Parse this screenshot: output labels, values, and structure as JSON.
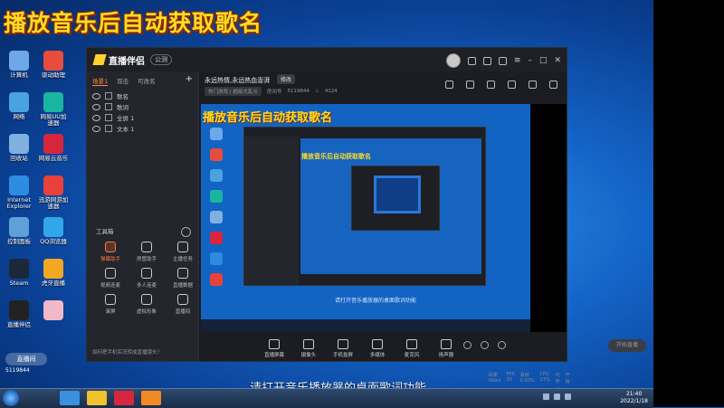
{
  "overlay_title": "播放音乐后自动获取歌名",
  "subtitle": "请打开音乐播放器的桌面歌词功能",
  "desktop_icons": [
    {
      "label": "计算机",
      "color": "#6fa8e8",
      "col": 0,
      "row": 0
    },
    {
      "label": "驱动助理",
      "color": "#e84c3d",
      "col": 1,
      "row": 0
    },
    {
      "label": "网络",
      "color": "#4aa3e0",
      "col": 0,
      "row": 1
    },
    {
      "label": "网易UU加速器",
      "color": "#18b6a0",
      "col": 1,
      "row": 1
    },
    {
      "label": "回收站",
      "color": "#7fb0e0",
      "col": 0,
      "row": 2
    },
    {
      "label": "网易云音乐",
      "color": "#d7263d",
      "col": 1,
      "row": 2
    },
    {
      "label": "Internet Explorer",
      "color": "#2d8be0",
      "col": 0,
      "row": 3
    },
    {
      "label": "迅游网游加速器",
      "color": "#e8413a",
      "col": 1,
      "row": 3
    },
    {
      "label": "控制面板",
      "color": "#5fa0d8",
      "col": 0,
      "row": 4
    },
    {
      "label": "QQ浏览器",
      "color": "#31a7ea",
      "col": 1,
      "row": 4
    },
    {
      "label": "Steam",
      "color": "#1b2838",
      "col": 0,
      "row": 5
    },
    {
      "label": "虎牙直播",
      "color": "#f5a623",
      "col": 1,
      "row": 5
    },
    {
      "label": "直播伴侣",
      "color": "#222222",
      "col": 0,
      "row": 6
    },
    {
      "label": "",
      "color": "#f2b8c6",
      "col": 1,
      "row": 6
    }
  ],
  "app": {
    "logo_text": "直播伴侣",
    "version_badge": "公测",
    "scene_tabs": [
      "场景1",
      "双击",
      "可改名"
    ],
    "add_label": "+",
    "sources": [
      "歌名",
      "歌词",
      "全屏 1",
      "文本 1"
    ],
    "toolbox_title": "工具箱",
    "tools": [
      {
        "label": "弹幕助手",
        "hot": true
      },
      {
        "label": "房管助手",
        "hot": false
      },
      {
        "label": "主播任务",
        "hot": false
      },
      {
        "label": "视频连麦",
        "hot": false
      },
      {
        "label": "多人连麦",
        "hot": false
      },
      {
        "label": "直播数据",
        "hot": false
      },
      {
        "label": "录屏",
        "hot": false
      },
      {
        "label": "虚拟形象",
        "hot": false
      },
      {
        "label": "直播间",
        "hot": false
      }
    ],
    "bottom_hint": "如何把手机实况转成直播镜头？",
    "stream_title": "永远热情,永远热血澎湃",
    "edit_label": "修改",
    "category": "热门游戏 | 超级大乱斗",
    "room_label": "房间号",
    "room_id": "5119844",
    "fans_count": "4124",
    "controls": [
      "直播屏幕",
      "摄像头",
      "手机投屏",
      "多媒体",
      "麦克风",
      "扬声器"
    ],
    "live_button": "开始直播",
    "status": [
      "码率 0kb/s",
      "FPS 30",
      "丢帧 0.00%",
      "CPU 17%",
      "内存 ...",
      "开始"
    ],
    "preview_caption": "请打开音乐播放器的桌面歌词功能"
  },
  "taskbar": {
    "apps": [
      {
        "color": "#3a8fe0"
      },
      {
        "color": "#f2c12e"
      },
      {
        "color": "#d7263d"
      },
      {
        "color": "#f08a24"
      }
    ],
    "time": "21:40",
    "date": "2022/1/18"
  },
  "watermark": {
    "badge": "直播间",
    "code": "5119844"
  }
}
